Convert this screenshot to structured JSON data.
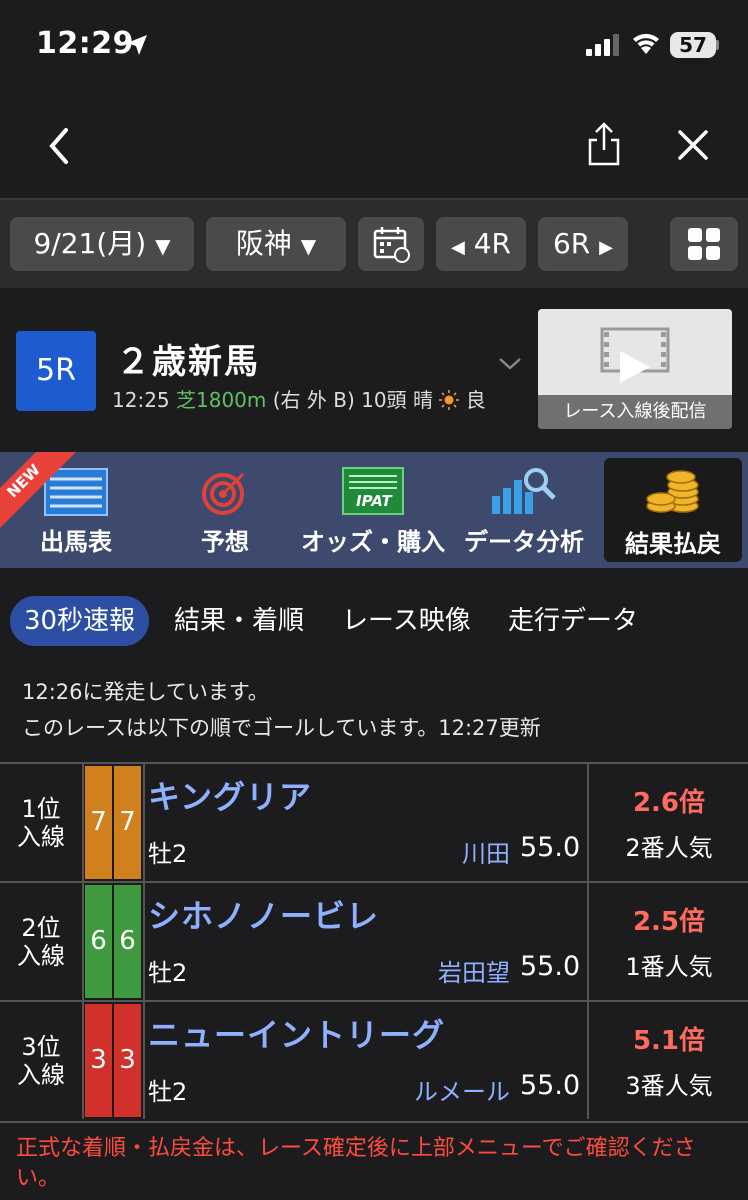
{
  "status_bar": {
    "time": "12:29",
    "battery": "57"
  },
  "toolbar": {
    "date": "9/21(月)",
    "venue": "阪神",
    "prev_race": "4R",
    "next_race": "6R"
  },
  "race": {
    "number": "5R",
    "title": "２歳新馬",
    "time": "12:25",
    "surface_distance": "芝1800m",
    "course": "(右 外 B)",
    "horses": "10頭",
    "weather": "晴",
    "condition": "良",
    "video_label": "レース入線後配信",
    "video_bg_text": "レース映像"
  },
  "menu": {
    "new_badge": "NEW",
    "items": [
      {
        "label": "出馬表",
        "icon": "list-icon"
      },
      {
        "label": "予想",
        "icon": "target-icon"
      },
      {
        "label": "オッズ・購入",
        "icon": "ipat-icon",
        "icon_text": "IPAT"
      },
      {
        "label": "データ分析",
        "icon": "chart-magnifier-icon"
      },
      {
        "label": "結果払戻",
        "icon": "coins-icon",
        "selected": true
      }
    ]
  },
  "tabs": [
    "30秒速報",
    "結果・着順",
    "レース映像",
    "走行データ"
  ],
  "messages": {
    "start": "12:26に発走しています。",
    "goal": "このレースは以下の順でゴールしています。12:27更新"
  },
  "results": [
    {
      "rank": "1位",
      "rank_sub": "入線",
      "waku": "7",
      "number": "7",
      "waku_color": "#d0801c",
      "name": "キングリア",
      "sex_age": "牡2",
      "jockey": "川田",
      "weight": "55.0",
      "odds": "2.6倍",
      "popularity": "2番人気"
    },
    {
      "rank": "2位",
      "rank_sub": "入線",
      "waku": "6",
      "number": "6",
      "waku_color": "#3f9a3f",
      "name": "シホノノービレ",
      "sex_age": "牡2",
      "jockey": "岩田望",
      "weight": "55.0",
      "odds": "2.5倍",
      "popularity": "1番人気"
    },
    {
      "rank": "3位",
      "rank_sub": "入線",
      "waku": "3",
      "number": "3",
      "waku_color": "#d1312b",
      "name": "ニューイントリーグ",
      "sex_age": "牡2",
      "jockey": "ルメール",
      "weight": "55.0",
      "odds": "5.1倍",
      "popularity": "3番人気"
    }
  ],
  "notice": "正式な着順・払戻金は、レース確定後に上部メニューでご確認ください。"
}
